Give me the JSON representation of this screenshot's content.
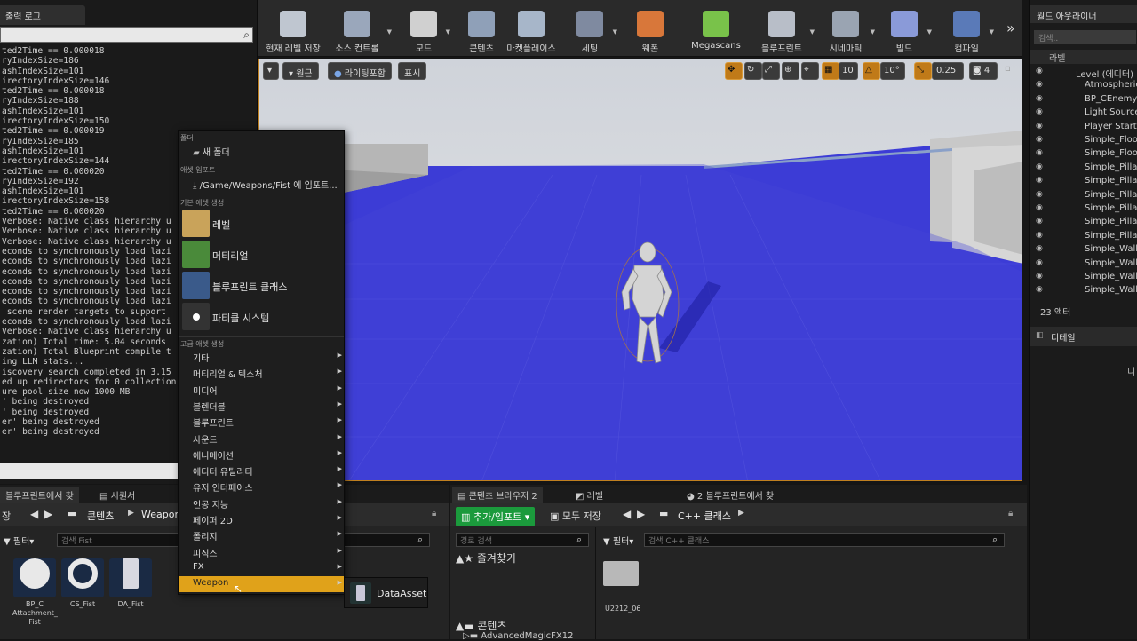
{
  "output_log": {
    "tab_label": "출력 로그",
    "lines": [
      "ted2Time == 0.000018",
      "ryIndexSize=186",
      "ashIndexSize=101",
      "irectoryIndexSize=146",
      "ted2Time == 0.000018",
      "ryIndexSize=188",
      "ashIndexSize=101",
      "irectoryIndexSize=150",
      "ted2Time == 0.000019",
      "ryIndexSize=185",
      "ashIndexSize=101",
      "irectoryIndexSize=144",
      "ted2Time == 0.000020",
      "ryIndexSize=192",
      "ashIndexSize=101",
      "irectoryIndexSize=158",
      "ted2Time == 0.000020",
      "Verbose: Native class hierarchy u",
      "Verbose: Native class hierarchy u",
      "Verbose: Native class hierarchy u",
      "econds to synchronously load lazi",
      "econds to synchronously load lazi",
      "econds to synchronously load lazi",
      "econds to synchronously load lazi",
      "econds to synchronously load lazi",
      "econds to synchronously load lazi",
      " scene render targets to support",
      "econds to synchronously load lazi",
      "Verbose: Native class hierarchy u",
      "zation) Total time: 5.04 seconds",
      "zation) Total Blueprint compile t",
      "ing LLM stats...",
      "iscovery search completed in 3.15",
      "ed up redirectors for 0 collection",
      "ure pool size now 1000 MB",
      "' being destroyed",
      "' being destroyed",
      "er' being destroyed",
      "er' being destroyed"
    ]
  },
  "toolbar": {
    "items": [
      {
        "label": "현재 레벨 저장",
        "icon": "save-icon"
      },
      {
        "label": "소스 컨트롤",
        "icon": "source-control-icon"
      },
      {
        "label": "모드",
        "icon": "modes-icon"
      },
      {
        "label": "콘텐츠",
        "icon": "content-icon"
      },
      {
        "label": "마켓플레이스",
        "icon": "marketplace-icon"
      },
      {
        "label": "세팅",
        "icon": "settings-icon"
      },
      {
        "label": "웨폰",
        "icon": "weapon-icon"
      },
      {
        "label": "Megascans",
        "icon": "megascans-icon"
      },
      {
        "label": "블루프린트",
        "icon": "blueprint-icon"
      },
      {
        "label": "시네마틱",
        "icon": "cinematics-icon"
      },
      {
        "label": "빌드",
        "icon": "build-icon"
      },
      {
        "label": "컴파일",
        "icon": "compile-icon"
      }
    ],
    "more": "»"
  },
  "viewport": {
    "perspective_label": "원근",
    "lit_label": "라이팅포함",
    "show_label": "표시",
    "grid_snap": "10",
    "rotate_snap": "10°",
    "scale_snap": "0.25",
    "camera_speed": "4"
  },
  "outliner": {
    "title": "월드 아웃라이너",
    "search_placeholder": "검색..",
    "column_label": "라벨",
    "items": [
      "Level (에디터)",
      "Atmospheric",
      "BP_CEnemy",
      "Light Source",
      "Player Start",
      "Simple_Floor",
      "Simple_Floor",
      "Simple_Pillar",
      "Simple_Pillar",
      "Simple_Pillar",
      "Simple_Pillar",
      "Simple_Pillar",
      "Simple_Pillar",
      "Simple_Wall_",
      "Simple_Wall_",
      "Simple_Wall_",
      "Simple_Wall_"
    ],
    "actor_count": "23 액터",
    "details_label": "디테일",
    "details_side_text": "디"
  },
  "context_menu": {
    "section_folder": "폴더",
    "new_folder": "새 폴더",
    "section_import": "애셋 임포트",
    "import_path": "/Game/Weapons/Fist 에 임포트...",
    "section_basic": "기본 애셋 생성",
    "basic_items": [
      "레벨",
      "머티리얼",
      "블루프린트 클래스",
      "파티클 시스템"
    ],
    "section_advanced": "고급 애셋 생성",
    "advanced_items": [
      "기타",
      "머티리얼 & 텍스처",
      "미디어",
      "블렌더블",
      "블루프린트",
      "사운드",
      "애니메이션",
      "에디터 유틸리티",
      "유저 인터페이스",
      "인공 지능",
      "페이퍼 2D",
      "폴리지",
      "피직스",
      "FX",
      "Weapon"
    ],
    "highlighted": "Weapon",
    "submenu_item": "DataAsset"
  },
  "left_browser": {
    "tabs": [
      "블루프린트에서 찾",
      "시퀀서"
    ],
    "save_label": "장",
    "path": [
      "콘텐츠",
      "Weapon"
    ],
    "filter_label": "필터",
    "search_placeholder": "검색 Fist",
    "assets": [
      {
        "name": "BP_C Attachment_ Fist"
      },
      {
        "name": "CS_Fist"
      },
      {
        "name": "DA_Fist"
      }
    ]
  },
  "content_browser_2": {
    "tabs": [
      "콘텐츠 브라우저 2",
      "레벨",
      "2 블루프린트에서 찾"
    ],
    "add_import": "추가/임포트",
    "save_all": "모두 저장",
    "path": [
      "C++ 클래스"
    ],
    "path_search_placeholder": "경로 검색",
    "favorites_label": "즐겨찾기",
    "content_label": "콘텐츠",
    "content_child": "AdvancedMagicFX12",
    "filter_label": "필터",
    "search_placeholder": "검색 C++ 클래스",
    "folder_name": "U2212_06"
  },
  "colors": {
    "accent_orange": "#e0a21a",
    "add_green": "#1b9a3c",
    "floor_blue": "#3b3bd4"
  }
}
